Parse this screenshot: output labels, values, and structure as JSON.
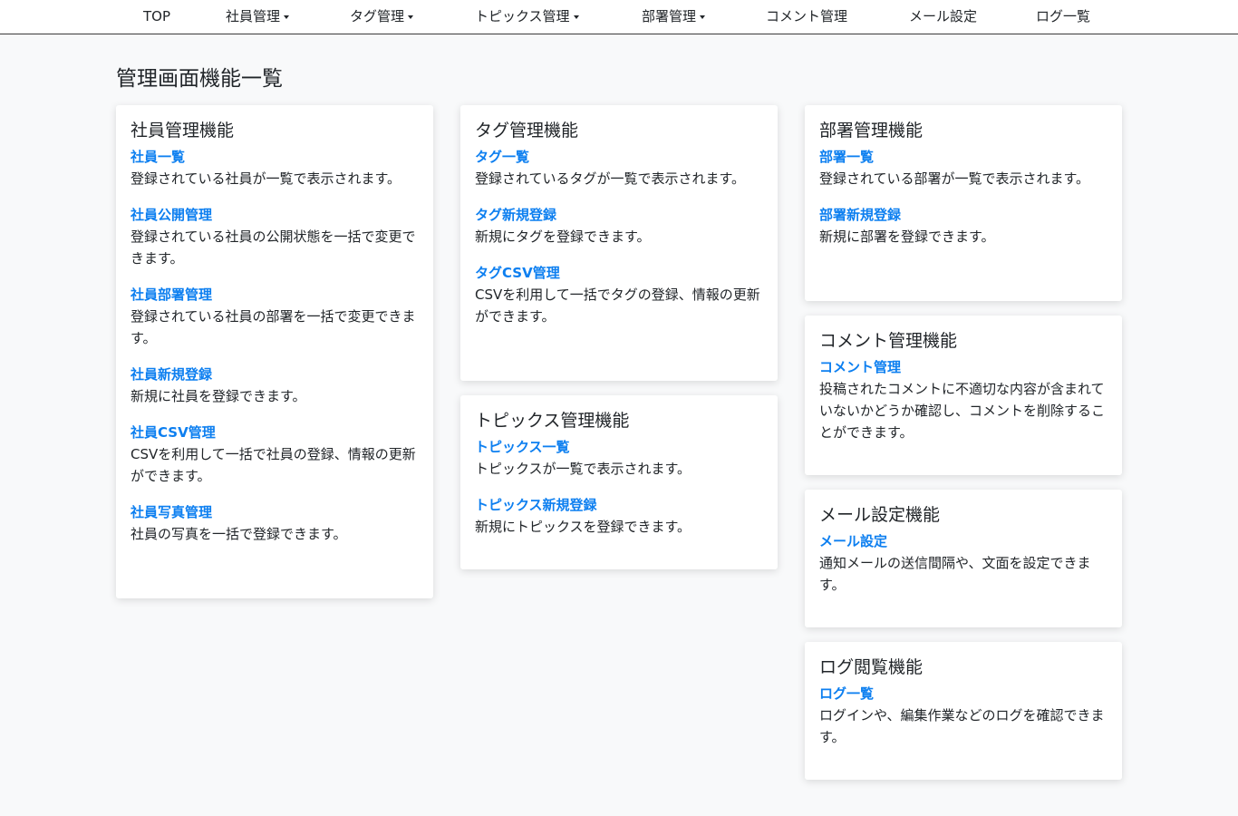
{
  "nav": {
    "items": [
      {
        "label": "TOP",
        "dropdown": false
      },
      {
        "label": "社員管理",
        "dropdown": true
      },
      {
        "label": "タグ管理",
        "dropdown": true
      },
      {
        "label": "トピックス管理",
        "dropdown": true
      },
      {
        "label": "部署管理",
        "dropdown": true
      },
      {
        "label": "コメント管理",
        "dropdown": false
      },
      {
        "label": "メール設定",
        "dropdown": false
      },
      {
        "label": "ログ一覧",
        "dropdown": false
      }
    ]
  },
  "page": {
    "title": "管理画面機能一覧"
  },
  "cards": {
    "employee": {
      "title": "社員管理機能",
      "items": [
        {
          "link": "社員一覧",
          "desc": "登録されている社員が一覧で表示されます。"
        },
        {
          "link": "社員公開管理",
          "desc": "登録されている社員の公開状態を一括で変更できます。"
        },
        {
          "link": "社員部署管理",
          "desc": "登録されている社員の部署を一括で変更できます。"
        },
        {
          "link": "社員新規登録",
          "desc": "新規に社員を登録できます。"
        },
        {
          "link": "社員CSV管理",
          "desc": "CSVを利用して一括で社員の登録、情報の更新ができます。"
        },
        {
          "link": "社員写真管理",
          "desc": "社員の写真を一括で登録できます。"
        }
      ]
    },
    "tag": {
      "title": "タグ管理機能",
      "items": [
        {
          "link": "タグ一覧",
          "desc": "登録されているタグが一覧で表示されます。"
        },
        {
          "link": "タグ新規登録",
          "desc": "新規にタグを登録できます。"
        },
        {
          "link": "タグCSV管理",
          "desc": "CSVを利用して一括でタグの登録、情報の更新ができます。"
        }
      ]
    },
    "topics": {
      "title": "トピックス管理機能",
      "items": [
        {
          "link": "トピックス一覧",
          "desc": "トピックスが一覧で表示されます。"
        },
        {
          "link": "トピックス新規登録",
          "desc": "新規にトピックスを登録できます。"
        }
      ]
    },
    "department": {
      "title": "部署管理機能",
      "items": [
        {
          "link": "部署一覧",
          "desc": "登録されている部署が一覧で表示されます。"
        },
        {
          "link": "部署新規登録",
          "desc": "新規に部署を登録できます。"
        }
      ]
    },
    "comment": {
      "title": "コメント管理機能",
      "items": [
        {
          "link": "コメント管理",
          "desc": "投稿されたコメントに不適切な内容が含まれていないかどうか確認し、コメントを削除することができます。"
        }
      ]
    },
    "mail": {
      "title": "メール設定機能",
      "items": [
        {
          "link": "メール設定",
          "desc": "通知メールの送信間隔や、文面を設定できます。"
        }
      ]
    },
    "log": {
      "title": "ログ閲覧機能",
      "items": [
        {
          "link": "ログ一覧",
          "desc": "ログインや、編集作業などのログを確認できます。"
        }
      ]
    }
  },
  "colors": {
    "link": "#0d7ff0",
    "background": "#f8f9fa",
    "card": "#ffffff",
    "text": "#212529"
  }
}
